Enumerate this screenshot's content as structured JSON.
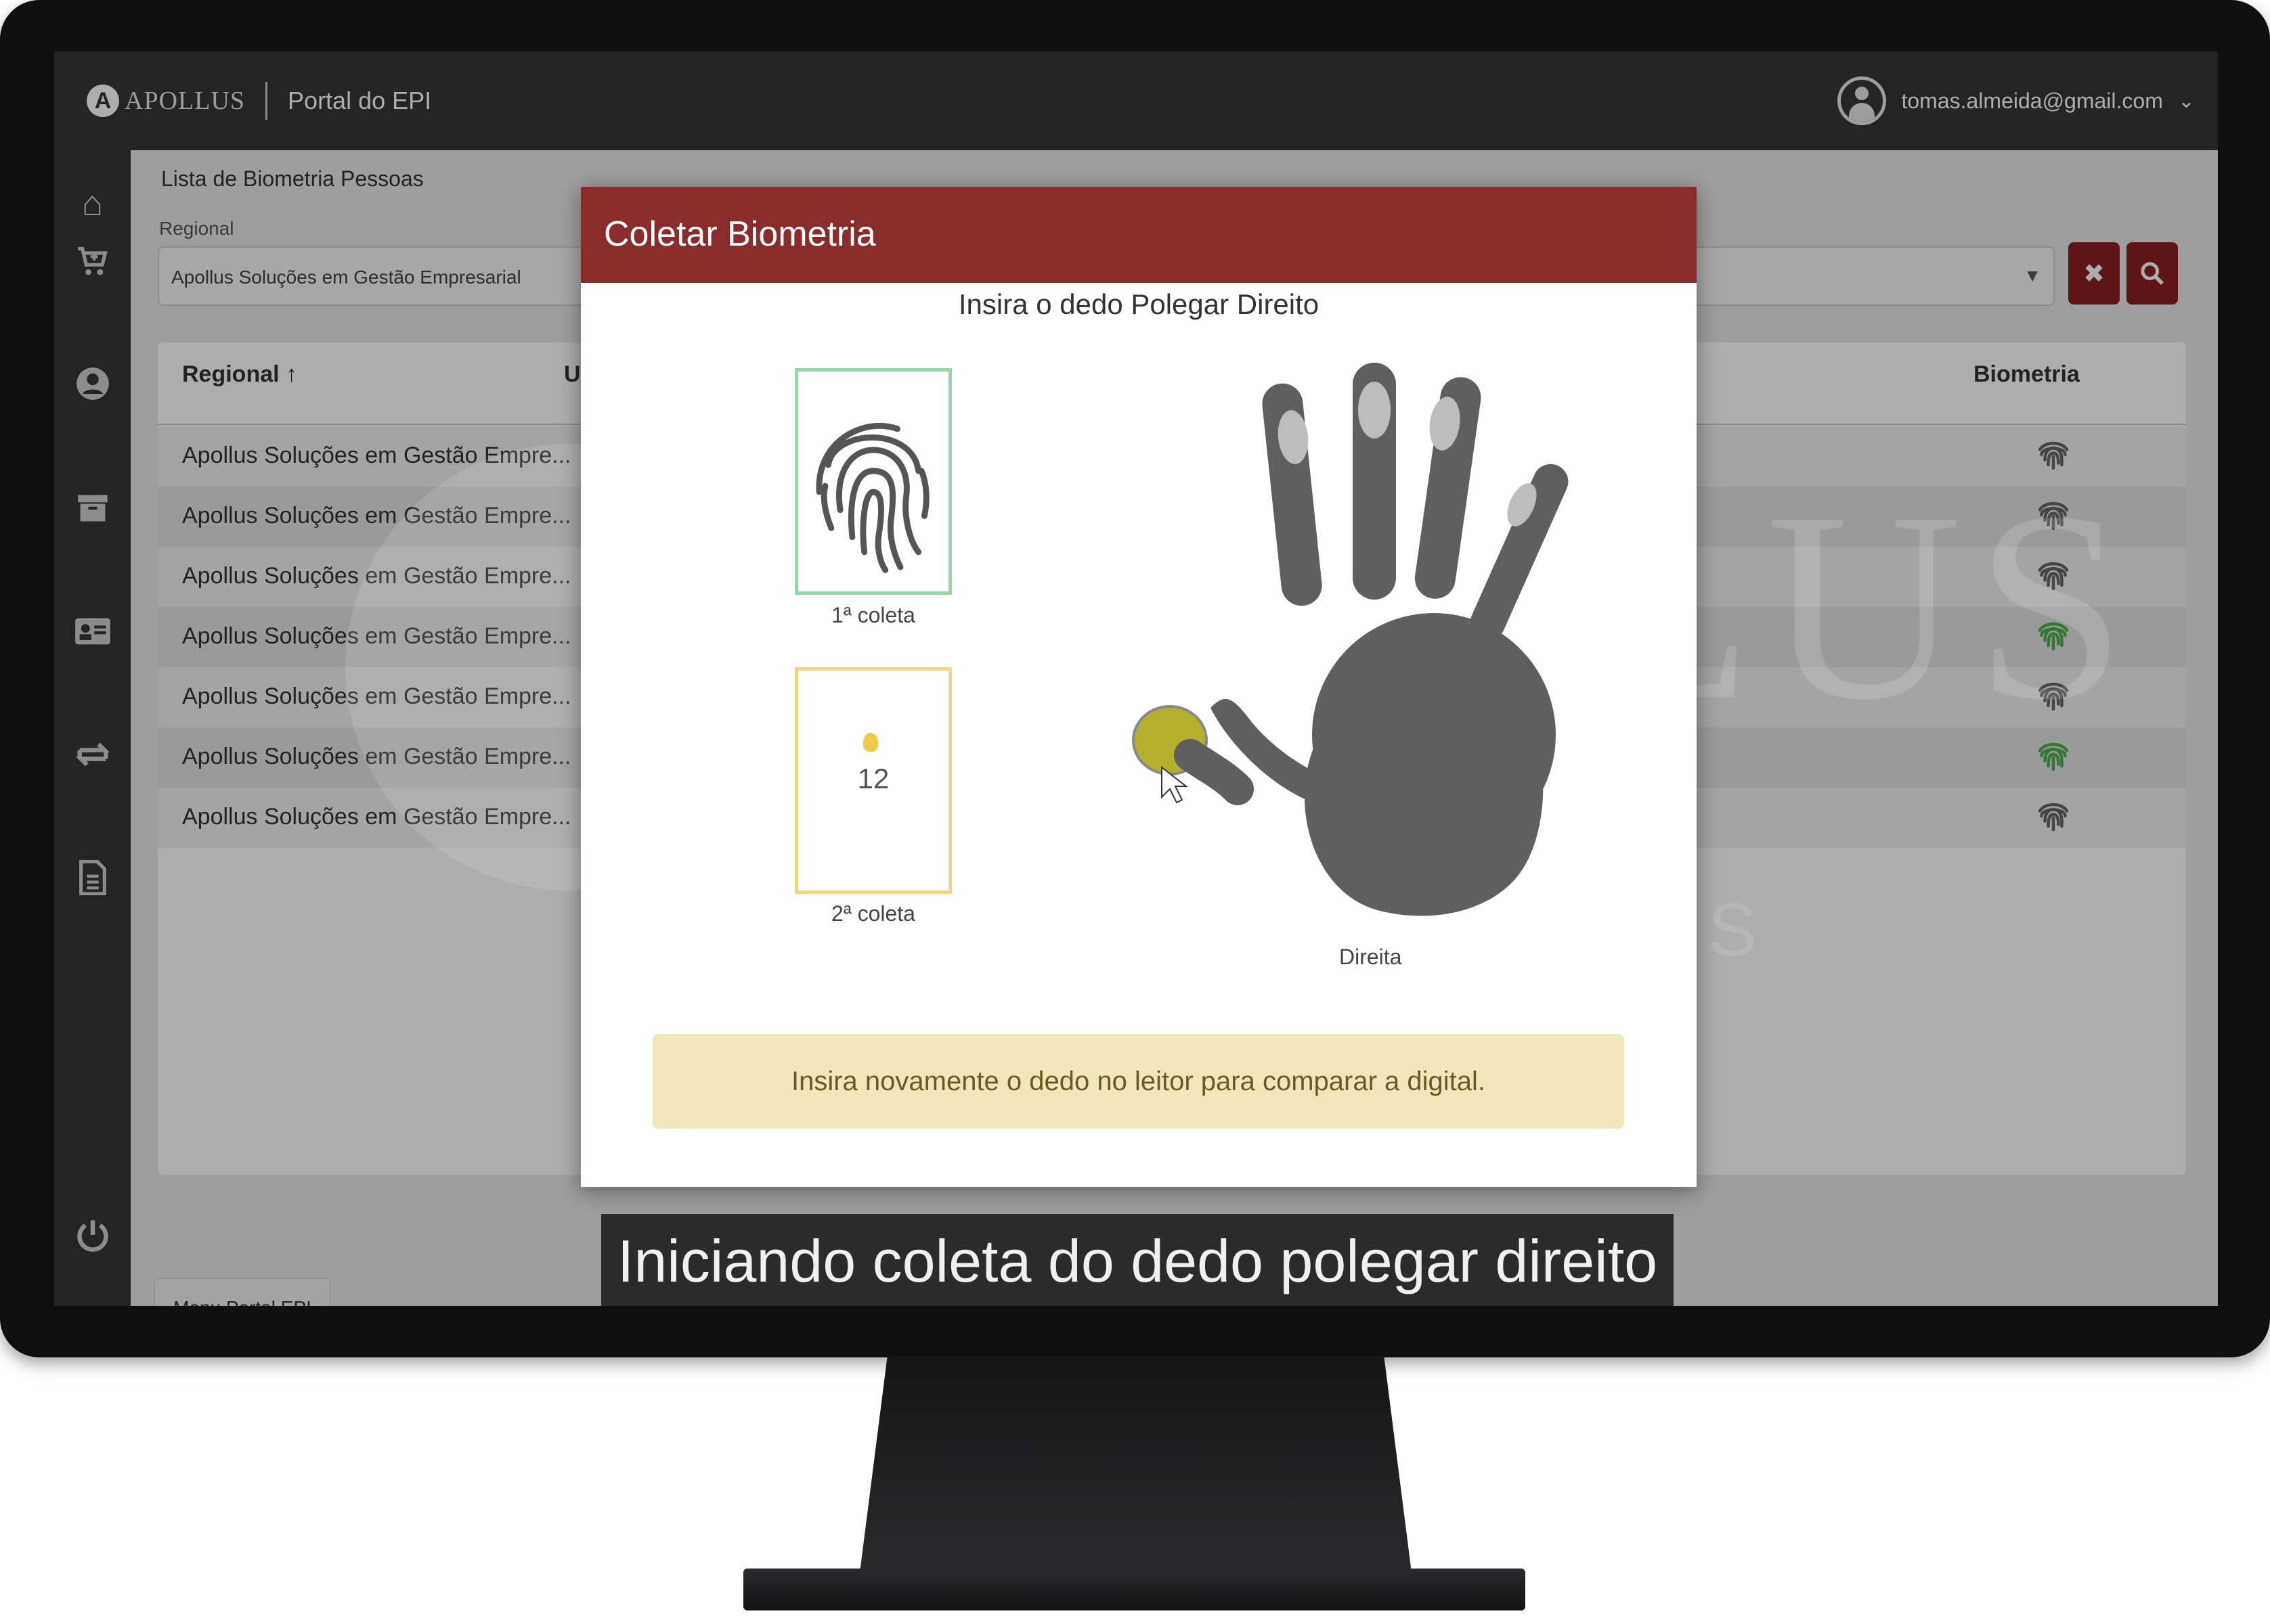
{
  "header": {
    "logo_initial": "A",
    "logo_text": "APOLLUS",
    "portal_title": "Portal do EPI",
    "user_email": "tomas.almeida@gmail.com"
  },
  "sidebar": {
    "items": [
      {
        "icon": "home-icon",
        "glyph": "⌂"
      },
      {
        "icon": "cart-icon",
        "glyph": "🛒"
      },
      {
        "icon": "user-icon",
        "glyph": "●"
      },
      {
        "icon": "archive-icon",
        "glyph": "▬"
      },
      {
        "icon": "id-card-icon",
        "glyph": "▤"
      },
      {
        "icon": "exchange-icon",
        "glyph": "⇆"
      },
      {
        "icon": "document-icon",
        "glyph": "▯"
      },
      {
        "icon": "power-icon",
        "glyph": "⏻"
      }
    ]
  },
  "main": {
    "page_title": "Lista de Biometria Pessoas",
    "regional_label": "Regional",
    "regional_value": "Apollus Soluções em Gestão Empresarial",
    "clear_glyph": "✖",
    "search_glyph": "⚲",
    "table": {
      "col_regional": "Regional ↑",
      "col_u": "U",
      "col_biometria": "Biometria",
      "rows": [
        {
          "regional": "Apollus Soluções em Gestão Empre...",
          "biometria_status": "gray"
        },
        {
          "regional": "Apollus Soluções em Gestão Empre...",
          "biometria_status": "gray"
        },
        {
          "regional": "Apollus Soluções em Gestão Empre...",
          "biometria_status": "gray"
        },
        {
          "regional": "Apollus Soluções em Gestão Empre...",
          "biometria_status": "green"
        },
        {
          "regional": "Apollus Soluções em Gestão Empre...",
          "biometria_status": "gray"
        },
        {
          "regional": "Apollus Soluções em Gestão Empre...",
          "biometria_status": "green"
        },
        {
          "regional": "Apollus Soluções em Gestão Empre...",
          "biometria_status": "gray"
        }
      ]
    },
    "footer_button": "Menu Portal EPI"
  },
  "watermark": {
    "word": "APOLLUS",
    "sub": "EHS SOLUTIONS"
  },
  "modal": {
    "title": "Coletar Biometria",
    "instruction": "Insira o dedo Polegar Direito",
    "first_collect_label": "1ª coleta",
    "second_collect_label": "2ª coleta",
    "second_collect_count": "12",
    "hand_label": "Direita",
    "alert": "Insira novamente o dedo no leitor para comparar a digital."
  },
  "caption": "Iniciando coleta do dedo polegar direito",
  "colors": {
    "header_bg": "#353536",
    "modal_header": "#8b2c2c",
    "action_button": "#8b1f1f",
    "status_green": "#4caf50",
    "status_gray": "#666666",
    "alert_bg": "#f2e6bb"
  }
}
